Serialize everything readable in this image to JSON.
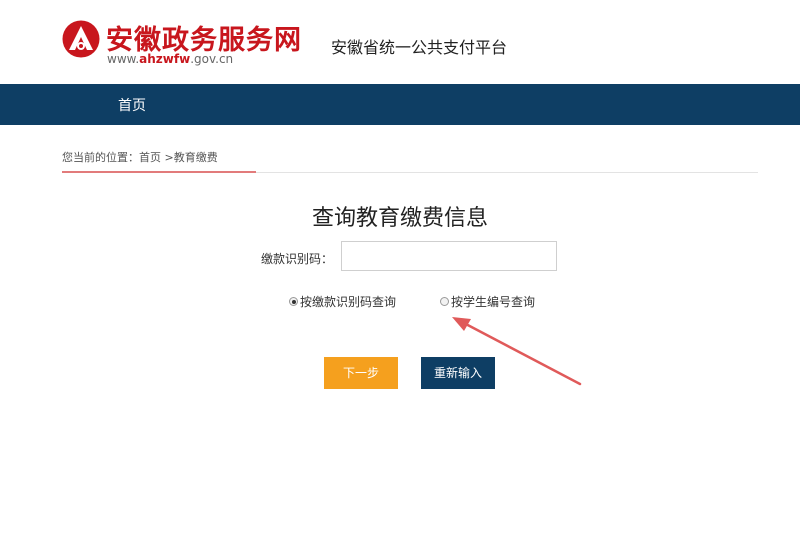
{
  "header": {
    "site_name": "安徽政务服务网",
    "url_prefix": "www.",
    "url_bold": "ahzwfw",
    "url_suffix": ".gov.cn",
    "platform_title": "安徽省统一公共支付平台"
  },
  "nav": {
    "home": "首页"
  },
  "breadcrumb": "您当前的位置：首页 >教育缴费",
  "main": {
    "title": "查询教育缴费信息",
    "code_label": "缴款识别码：",
    "code_value": "",
    "options": [
      {
        "label": "按缴款识别码查询",
        "selected": true
      },
      {
        "label": "按学生编号查询",
        "selected": false
      }
    ],
    "next_button": "下一步",
    "reset_button": "重新输入"
  },
  "colors": {
    "brand_red": "#c8161d",
    "nav_blue": "#0e3e64",
    "next_orange": "#f5a01e",
    "annotation_arrow": "#e05a5a"
  }
}
